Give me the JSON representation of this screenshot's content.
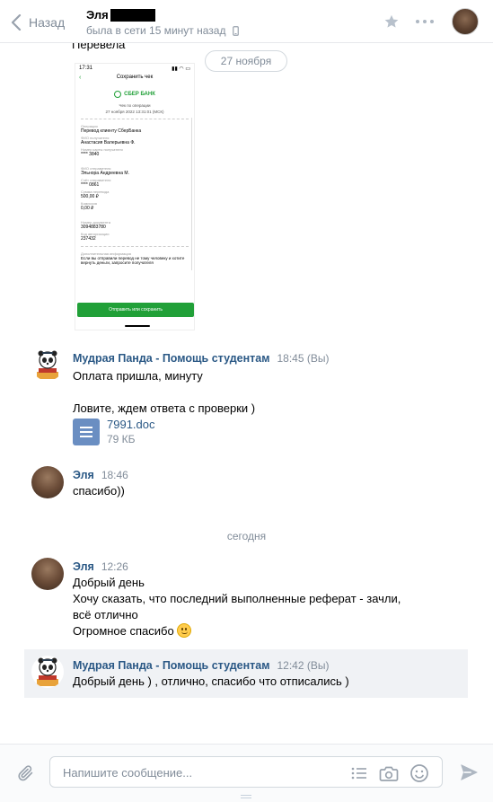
{
  "header": {
    "back_label": "Назад",
    "peer_name": "Эля",
    "peer_status": "была в сети 15 минут назад"
  },
  "chat": {
    "prev_tail": "Перевела",
    "date_pill": "27 ноября",
    "receipt": {
      "status_time": "17:31",
      "title": "Сохранить чек",
      "bank": "СБЕР БАНК",
      "line1": "Чек по операции",
      "line2": "27 ноября 2022 13:31:01 (МСК)",
      "fields": [
        {
          "k": "Операция",
          "v": "Перевод клиенту СберБанка"
        },
        {
          "k": "ФИО получателя",
          "v": "Анастасия Валерьевна Ф."
        },
        {
          "k": "Номер карты получателя",
          "v": "**** 3840"
        },
        {
          "k": "ФИО отправителя",
          "v": "Эльнора Андреевна М."
        },
        {
          "k": "Счёт отправителя",
          "v": "**** 0861"
        },
        {
          "k": "Сумма перевода",
          "v": "500,00 ₽"
        },
        {
          "k": "Комиссия",
          "v": "0,00 ₽"
        },
        {
          "k": "Номер документа",
          "v": "3094883780"
        },
        {
          "k": "Код авторизации",
          "v": "237432"
        },
        {
          "k": "Дополнительная информация",
          "v": "Если вы отправили перевод не тому человеку и хотите вернуть деньги, запросите получателя"
        }
      ],
      "button": "Отправить или сохранить"
    },
    "messages": [
      {
        "author": "Мудрая Панда - Помощь студентам",
        "time": "18:45 (Вы)",
        "lines": [
          "Оплата пришла, минуту",
          "",
          "Ловите, ждем ответа с проверки )"
        ],
        "doc": {
          "name": "7991.doc",
          "size": "79 КБ"
        }
      },
      {
        "author": "Эля",
        "time": "18:46",
        "lines": [
          "спасибо))"
        ]
      },
      {
        "author": "Эля",
        "time": "12:26",
        "lines": [
          "Добрый день",
          "Хочу сказать, что последний выполненные реферат - зачли,",
          "всё отлично",
          "Огромное спасибо"
        ]
      },
      {
        "author": "Мудрая Панда - Помощь студентам",
        "time": "12:42 (Вы)",
        "lines": [
          "Добрый день ) , отлично, спасибо что отписались )"
        ]
      }
    ],
    "day_separator": "сегодня"
  },
  "composer": {
    "placeholder": "Напишите сообщение..."
  },
  "colors": {
    "link_blue": "#2a5885",
    "muted": "#818c99",
    "sber_green": "#21a038",
    "selected_bg": "#f0f2f5"
  }
}
